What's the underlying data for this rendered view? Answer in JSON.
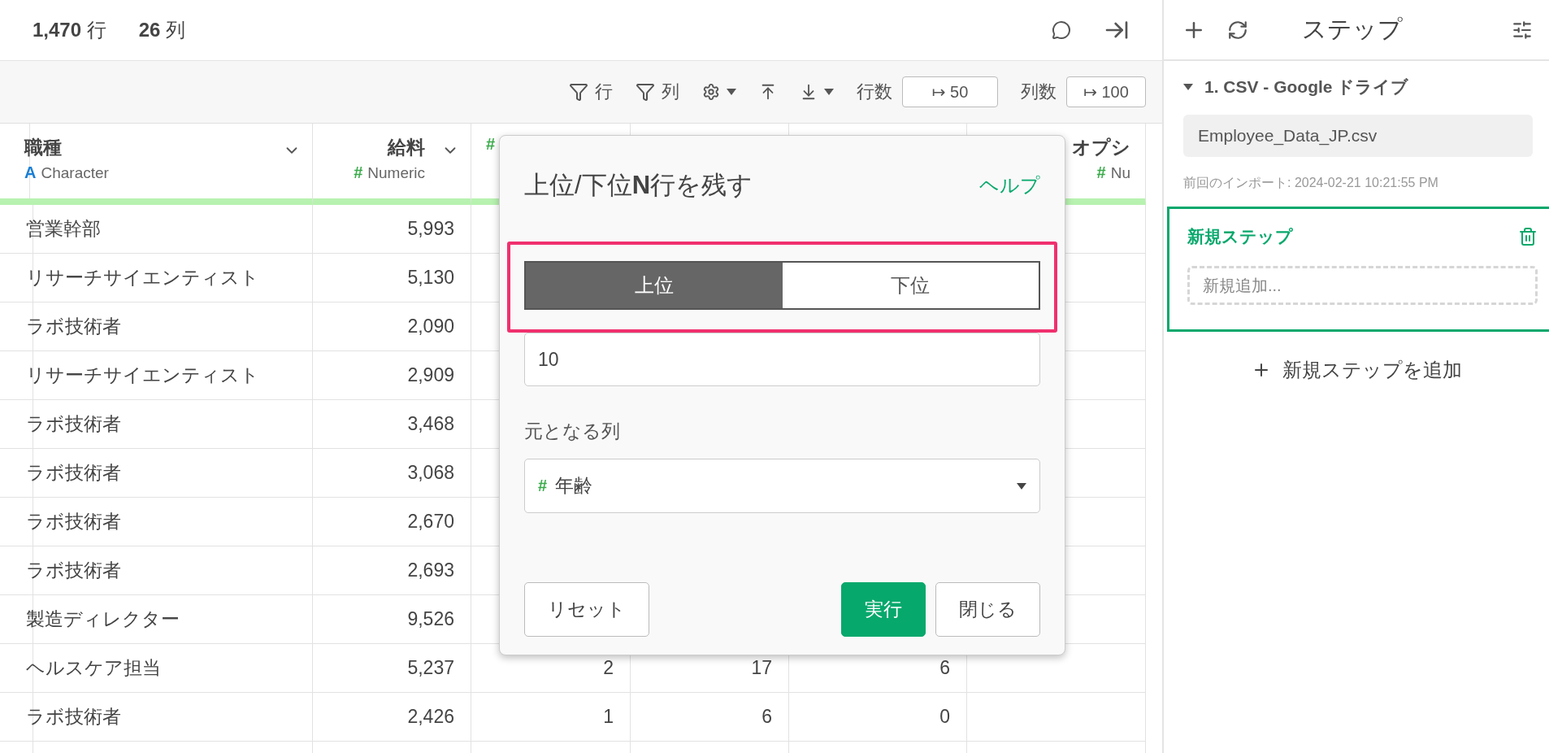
{
  "summary": {
    "rows": "**1,470** 行",
    "columns": "**26** 列"
  },
  "toolbar": {
    "row_filter": "行",
    "column_filter": "列",
    "row_count_label": "行数",
    "row_count": "↦ 50",
    "column_count_label": "列数",
    "column_count": "↦ 100"
  },
  "table": {
    "columns": [
      {
        "name": "職種",
        "type_icon": "A",
        "type": "Character",
        "kind": "text",
        "menu": true
      },
      {
        "name": "給料",
        "type_icon": "#",
        "type": "Numeric",
        "kind": "number",
        "menu": true
      },
      {
        "type_icon": "#",
        "kind": "number"
      },
      {
        "kind": "number"
      },
      {
        "kind": "number"
      },
      {
        "name": "オプシ",
        "type_icon": "#",
        "type": "Nu",
        "kind": "number",
        "menu": false
      }
    ],
    "rows": [
      {
        "cells": [
          "営業幹部",
          "5,993"
        ]
      },
      {
        "cells": [
          "リサーチサイエンティスト",
          "5,130"
        ]
      },
      {
        "cells": [
          "ラボ技術者",
          "2,090"
        ]
      },
      {
        "cells": [
          "リサーチサイエンティスト",
          "2,909"
        ]
      },
      {
        "cells": [
          "ラボ技術者",
          "3,468"
        ]
      },
      {
        "cells": [
          "ラボ技術者",
          "3,068"
        ]
      },
      {
        "cells": [
          "ラボ技術者",
          "2,670"
        ]
      },
      {
        "cells": [
          "ラボ技術者",
          "2,693"
        ]
      },
      {
        "cells": [
          "製造ディレクター",
          "9,526"
        ]
      },
      {
        "cells": [
          "ヘルスケア担当",
          "5,237",
          "2",
          "17",
          "6"
        ]
      },
      {
        "cells": [
          "ラボ技術者",
          "2,426",
          "1",
          "6",
          "0"
        ]
      }
    ]
  },
  "dialog": {
    "title": "上位/下位**N**行を残す",
    "help": "ヘルプ",
    "highlighted": true,
    "segments": [
      {
        "label": "上位",
        "selected": true
      },
      {
        "label": "下位",
        "selected": false
      }
    ],
    "count": "10",
    "column_label": "元となる列",
    "column_icon": "#",
    "column": "年齢",
    "buttons": [
      {
        "label": "リセット",
        "kind": "plain"
      },
      {
        "label": "実行",
        "kind": "primary"
      },
      {
        "label": "閉じる",
        "kind": "plain"
      }
    ]
  },
  "steps_panel": {
    "title": "ステップ",
    "source": {
      "title": "1. CSV - Google ドライブ",
      "expanded": true,
      "file": "Employee_Data_JP.csv",
      "imported": "前回のインポート: 2024-02-21 10:21:55 PM"
    },
    "new_step": {
      "title": "新規ステップ",
      "placeholder": "新規追加..."
    },
    "add_step": "新規ステップを追加"
  }
}
